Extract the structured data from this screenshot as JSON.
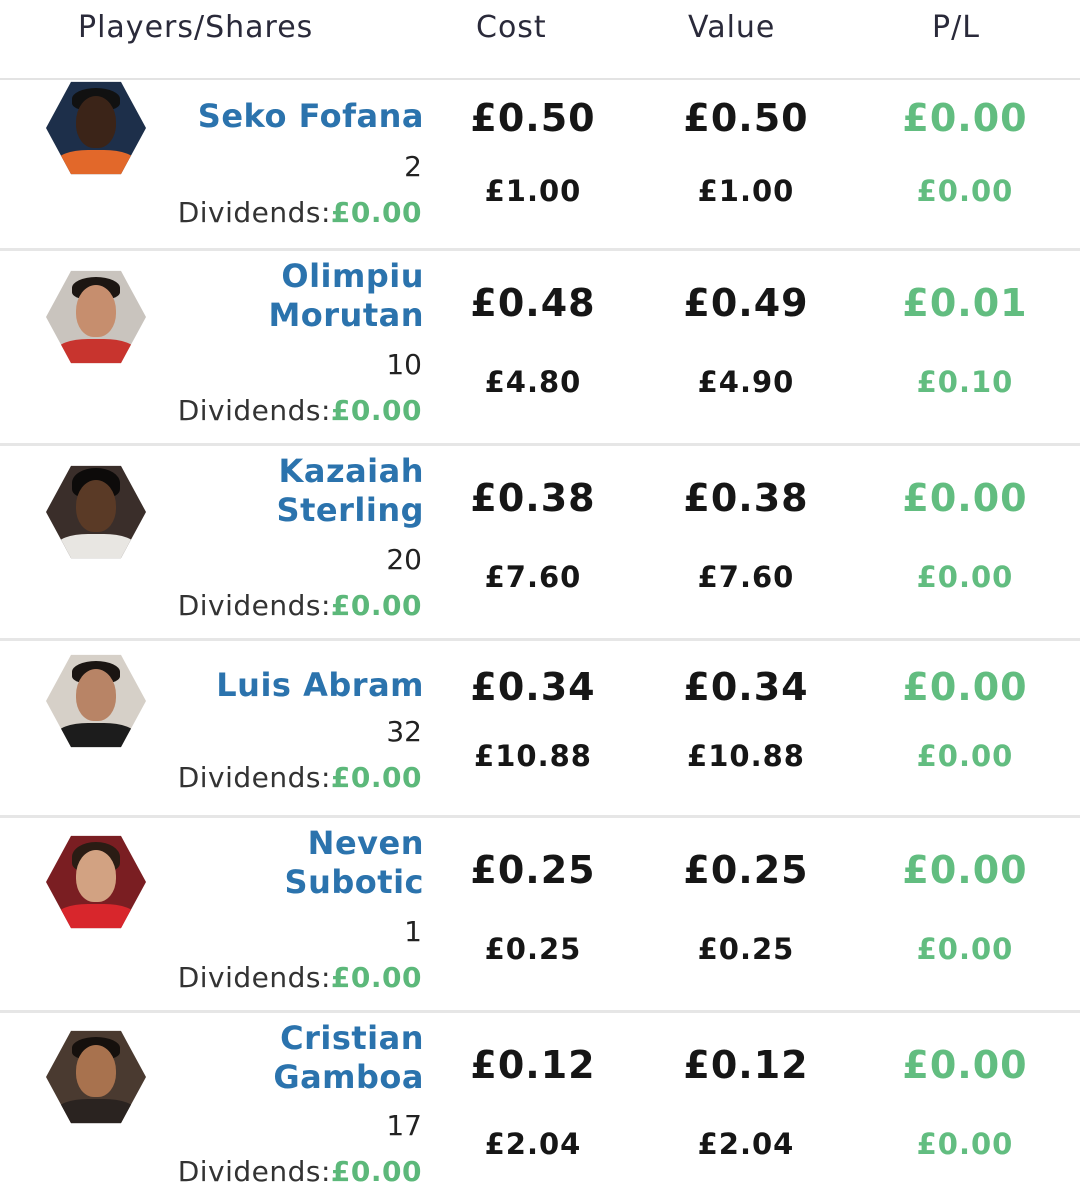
{
  "header": {
    "players_label": "Players/Shares",
    "cost_label": "Cost",
    "value_label": "Value",
    "pl_label": "P/L"
  },
  "rows": [
    {
      "name_line1": "Seko Fofana",
      "name_line2": "",
      "shares": "2",
      "dividends_label": "Dividends:",
      "dividends_value": "£0.00",
      "cost_per_share": "£0.50",
      "cost_total": "£1.00",
      "value_per_share": "£0.50",
      "value_total": "£1.00",
      "pl_per_share": "£0.00",
      "pl_total": "£0.00"
    },
    {
      "name_line1": "Olimpiu",
      "name_line2": "Morutan",
      "shares": "10",
      "dividends_label": "Dividends:",
      "dividends_value": "£0.00",
      "cost_per_share": "£0.48",
      "cost_total": "£4.80",
      "value_per_share": "£0.49",
      "value_total": "£4.90",
      "pl_per_share": "£0.01",
      "pl_total": "£0.10"
    },
    {
      "name_line1": "Kazaiah",
      "name_line2": "Sterling",
      "shares": "20",
      "dividends_label": "Dividends:",
      "dividends_value": "£0.00",
      "cost_per_share": "£0.38",
      "cost_total": "£7.60",
      "value_per_share": "£0.38",
      "value_total": "£7.60",
      "pl_per_share": "£0.00",
      "pl_total": "£0.00"
    },
    {
      "name_line1": "Luis Abram",
      "name_line2": "",
      "shares": "32",
      "dividends_label": "Dividends:",
      "dividends_value": "£0.00",
      "cost_per_share": "£0.34",
      "cost_total": "£10.88",
      "value_per_share": "£0.34",
      "value_total": "£10.88",
      "pl_per_share": "£0.00",
      "pl_total": "£0.00"
    },
    {
      "name_line1": "Neven",
      "name_line2": "Subotic",
      "shares": "1",
      "dividends_label": "Dividends:",
      "dividends_value": "£0.00",
      "cost_per_share": "£0.25",
      "cost_total": "£0.25",
      "value_per_share": "£0.25",
      "value_total": "£0.25",
      "pl_per_share": "£0.00",
      "pl_total": "£0.00"
    },
    {
      "name_line1": "Cristian",
      "name_line2": "Gamboa",
      "shares": "17",
      "dividends_label": "Dividends:",
      "dividends_value": "£0.00",
      "cost_per_share": "£0.12",
      "cost_total": "£2.04",
      "value_per_share": "£0.12",
      "value_total": "£2.04",
      "pl_per_share": "£0.00",
      "pl_total": "£0.00"
    }
  ],
  "colors": {
    "name_blue": "#2b73ad",
    "profit_green": "#62bd80",
    "divider": "#e6e6e6"
  }
}
